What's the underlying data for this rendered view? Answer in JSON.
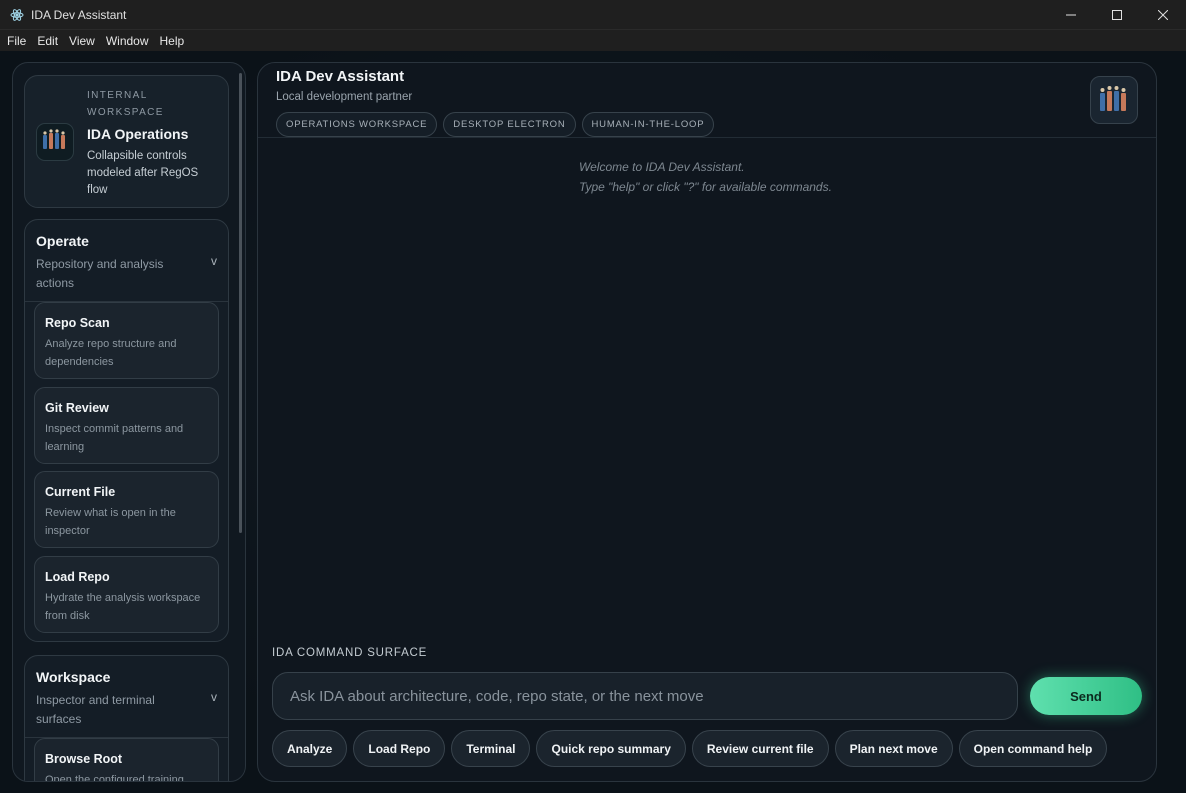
{
  "window": {
    "title": "IDA Dev Assistant",
    "menu": [
      "File",
      "Edit",
      "View",
      "Window",
      "Help"
    ]
  },
  "sidebar": {
    "brand": {
      "eyebrow": "INTERNAL WORKSPACE",
      "title": "IDA Operations",
      "subtitle": "Collapsible controls modeled after RegOS flow"
    },
    "sections": [
      {
        "title": "Operate",
        "subtitle": "Repository and analysis actions",
        "chevron": "v",
        "actions": [
          {
            "title": "Repo Scan",
            "desc": "Analyze repo structure and dependencies"
          },
          {
            "title": "Git Review",
            "desc": "Inspect commit patterns and learning"
          },
          {
            "title": "Current File",
            "desc": "Review what is open in the inspector"
          },
          {
            "title": "Load Repo",
            "desc": "Hydrate the analysis workspace from disk"
          }
        ]
      },
      {
        "title": "Workspace",
        "subtitle": "Inspector and terminal surfaces",
        "chevron": "v",
        "actions": [
          {
            "title": "Browse Root",
            "desc": "Open the configured training"
          }
        ]
      }
    ]
  },
  "main": {
    "title": "IDA Dev Assistant",
    "subtitle": "Local development partner",
    "chips": [
      "OPERATIONS WORKSPACE",
      "DESKTOP ELECTRON",
      "HUMAN-IN-THE-LOOP"
    ],
    "welcome_line1": "Welcome to IDA Dev Assistant.",
    "welcome_line2": "Type \"help\" or click \"?\" for available commands.",
    "command": {
      "label": "IDA COMMAND SURFACE",
      "placeholder": "Ask IDA about architecture, code, repo state, or the next move",
      "value": "",
      "send_label": "Send"
    },
    "quick_actions": [
      "Analyze",
      "Load Repo",
      "Terminal",
      "Quick repo summary",
      "Review current file",
      "Plan next move",
      "Open command help"
    ]
  },
  "colors": {
    "accent": "#3fd198",
    "background": "#0d141a",
    "panel": "#0f161e"
  }
}
